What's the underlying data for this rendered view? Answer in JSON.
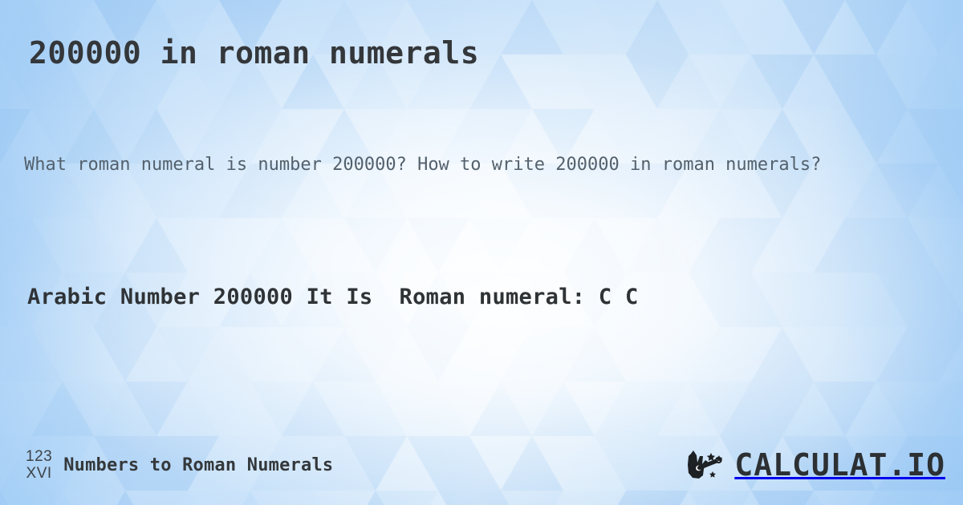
{
  "header": {
    "title": "200000 in roman numerals"
  },
  "intro": {
    "text": "What roman numeral is number 200000? How to write 200000 in roman numerals?"
  },
  "result": {
    "line": "Arabic Number 200000 It Is  Roman numeral: C C",
    "arabic_label": "Arabic Number",
    "arabic_value": "200000",
    "connector": "It Is",
    "roman_label": "Roman numeral:",
    "roman_value": "C C"
  },
  "footer": {
    "logo_mark_top": "123",
    "logo_mark_bottom": "XVI",
    "site_title": "Numbers to Roman Numerals",
    "brand_name": "CALCULAT.IO",
    "brand_icon": "hand-magic-wand-icon"
  },
  "colors": {
    "background_blue": "#aed4f8",
    "background_light": "#ffffff",
    "title_text": "#34373a",
    "body_text": "#53616d",
    "result_text": "#2f3336",
    "brand_text": "#2c3033"
  }
}
